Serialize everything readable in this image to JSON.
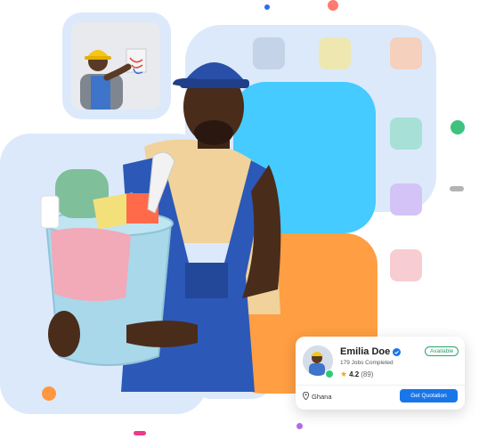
{
  "profile_card": {
    "name": "Emilia Doe",
    "jobs_completed": "179 Jobs Completed",
    "rating": "4.2",
    "rating_count": "(89)",
    "status": "Available",
    "location": "Ghana",
    "cta_label": "Get Quotation"
  },
  "icons": {
    "verified": "verified-badge-icon",
    "star": "star-icon",
    "location": "location-pin-icon"
  },
  "colors": {
    "accent_blue": "#1976e8",
    "available_green": "#2aa36a",
    "cyan_block": "#45cbff",
    "orange_block": "#ff9e42",
    "light_blue_block": "#dce9fb"
  }
}
